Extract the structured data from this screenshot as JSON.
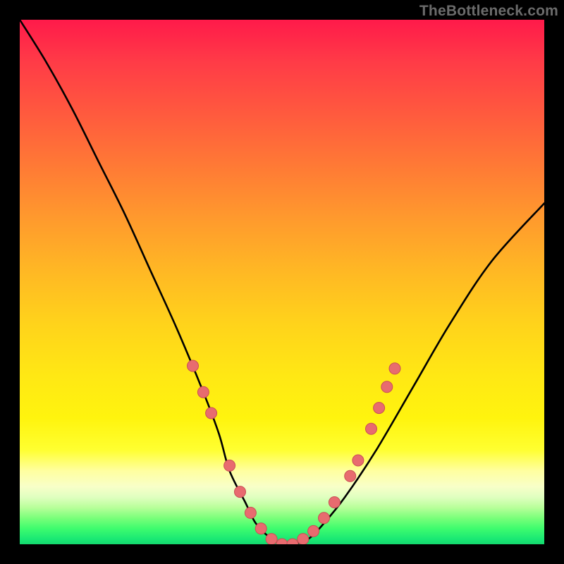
{
  "watermark": "TheBottleneck.com",
  "chart_data": {
    "type": "line",
    "title": "",
    "xlabel": "",
    "ylabel": "",
    "xlim": [
      0,
      100
    ],
    "ylim": [
      0,
      100
    ],
    "grid": false,
    "legend": false,
    "background_gradient": {
      "top": "#ff1a4a",
      "mid_upper": "#ffb824",
      "mid_lower": "#ffff30",
      "band": "#ffffa0",
      "bottom": "#14d86e"
    },
    "series": [
      {
        "name": "bottleneck-curve",
        "stroke": "#000000",
        "x": [
          0,
          5,
          10,
          15,
          20,
          25,
          30,
          35,
          38,
          40,
          43,
          45,
          48,
          50,
          52,
          55,
          58,
          62,
          68,
          75,
          82,
          90,
          100
        ],
        "y": [
          100,
          92,
          83,
          73,
          63,
          52,
          41,
          29,
          21,
          14,
          8,
          4,
          1,
          0,
          0,
          1,
          4,
          9,
          18,
          30,
          42,
          54,
          65
        ]
      }
    ],
    "markers": {
      "name": "highlighted-points",
      "fill": "#e86b6f",
      "stroke": "#c94f55",
      "radius_px": 8,
      "points": [
        {
          "x": 33,
          "y": 34
        },
        {
          "x": 35,
          "y": 29
        },
        {
          "x": 36.5,
          "y": 25
        },
        {
          "x": 40,
          "y": 15
        },
        {
          "x": 42,
          "y": 10
        },
        {
          "x": 44,
          "y": 6
        },
        {
          "x": 46,
          "y": 3
        },
        {
          "x": 48,
          "y": 1
        },
        {
          "x": 50,
          "y": 0
        },
        {
          "x": 52,
          "y": 0
        },
        {
          "x": 54,
          "y": 1
        },
        {
          "x": 56,
          "y": 2.5
        },
        {
          "x": 58,
          "y": 5
        },
        {
          "x": 60,
          "y": 8
        },
        {
          "x": 63,
          "y": 13
        },
        {
          "x": 64.5,
          "y": 16
        },
        {
          "x": 67,
          "y": 22
        },
        {
          "x": 68.5,
          "y": 26
        },
        {
          "x": 70,
          "y": 30
        },
        {
          "x": 71.5,
          "y": 33.5
        }
      ]
    }
  }
}
